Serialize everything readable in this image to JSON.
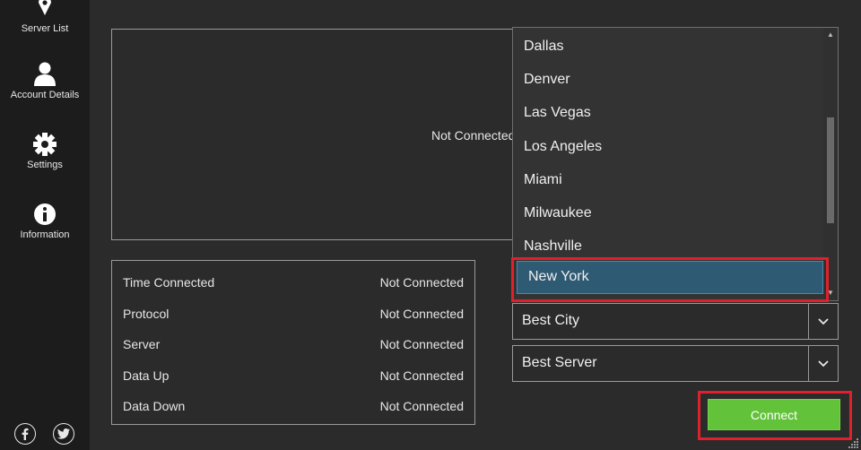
{
  "sidebar": {
    "items": [
      {
        "label": "Server List",
        "icon": "location-pin-icon"
      },
      {
        "label": "Account Details",
        "icon": "user-icon"
      },
      {
        "label": "Settings",
        "icon": "gear-icon"
      },
      {
        "label": "Information",
        "icon": "info-icon"
      }
    ],
    "social": [
      "facebook-icon",
      "twitter-icon"
    ]
  },
  "status_panel": {
    "status": "Not Connected"
  },
  "info_table": {
    "rows": [
      {
        "label": "Time Connected",
        "value": "Not Connected"
      },
      {
        "label": "Protocol",
        "value": "Not Connected"
      },
      {
        "label": "Server",
        "value": "Not Connected"
      },
      {
        "label": "Data Up",
        "value": "Not Connected"
      },
      {
        "label": "Data Down",
        "value": "Not Connected"
      }
    ]
  },
  "city_dropdown": {
    "options": [
      "Dallas",
      "Denver",
      "Las Vegas",
      "Los Angeles",
      "Miami",
      "Milwaukee",
      "Nashville",
      "New York"
    ],
    "highlighted": "New York"
  },
  "city_select": {
    "value": "Best City"
  },
  "server_select": {
    "value": "Best Server"
  },
  "connect_button": {
    "label": "Connect"
  },
  "colors": {
    "background": "#2b2b2b",
    "sidebar": "#1c1c1c",
    "connect": "#62c33b",
    "selected_item": "#2f5a73",
    "highlight_box": "#e0202a"
  }
}
